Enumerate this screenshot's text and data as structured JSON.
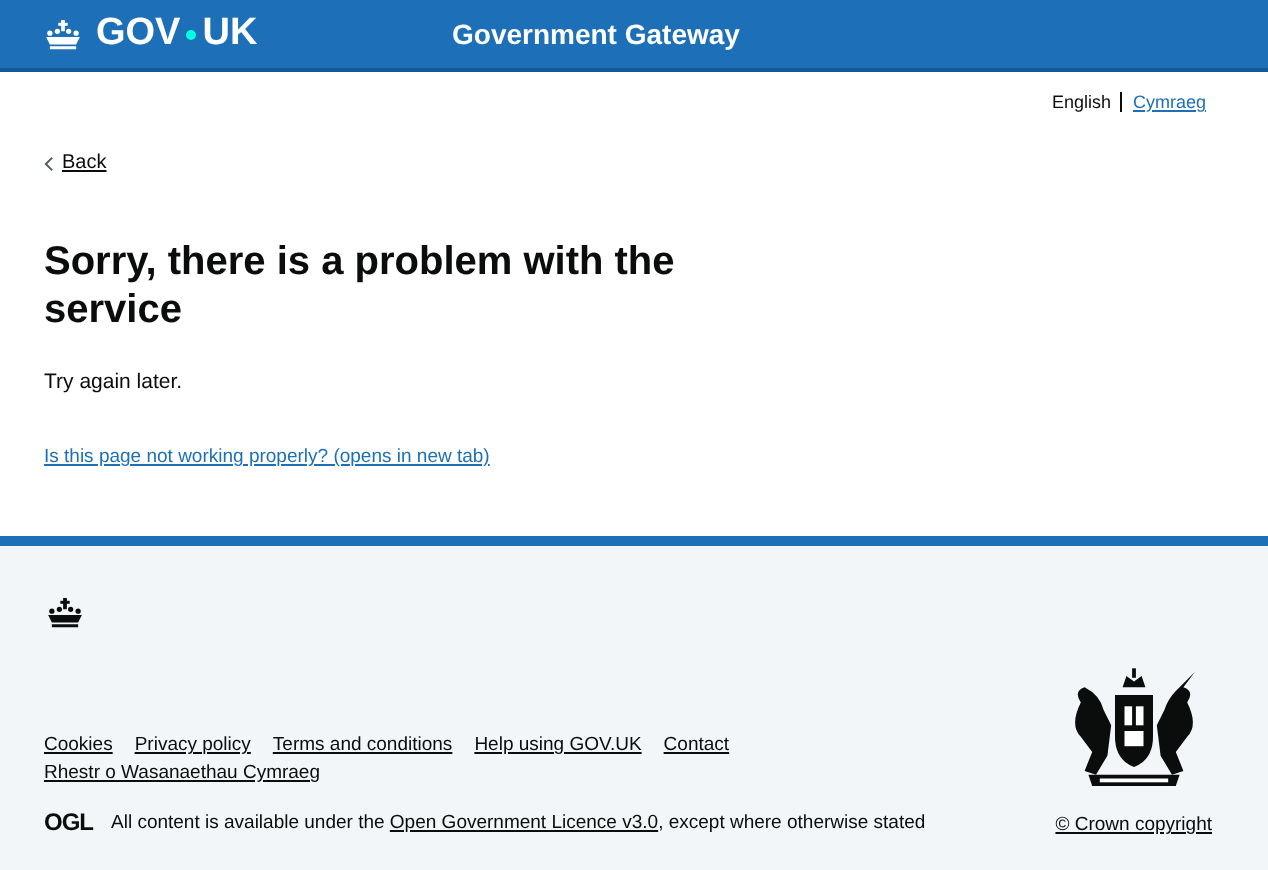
{
  "header": {
    "logo_left": "GOV",
    "logo_right": "UK",
    "service_name": "Government Gateway"
  },
  "language_toggle": [
    {
      "label": "English",
      "selected": true
    },
    {
      "label": "Cymraeg",
      "selected": false
    }
  ],
  "back_link": "Back",
  "heading": "Sorry, there is a problem with the service",
  "body": "Try again later.",
  "report_link": "Is this page not working properly? (opens in new tab)",
  "footer": {
    "links": [
      "Cookies",
      "Privacy policy",
      "Terms and conditions",
      "Help using GOV.UK",
      "Contact",
      "Rhestr o Wasanaethau Cymraeg"
    ],
    "licence_logo": "OGL",
    "licence_before": "All content is available under the",
    "licence_link": "Open Government Licence v3.0",
    "licence_after": ", except where otherwise stated",
    "copyright": "© Crown copyright"
  }
}
